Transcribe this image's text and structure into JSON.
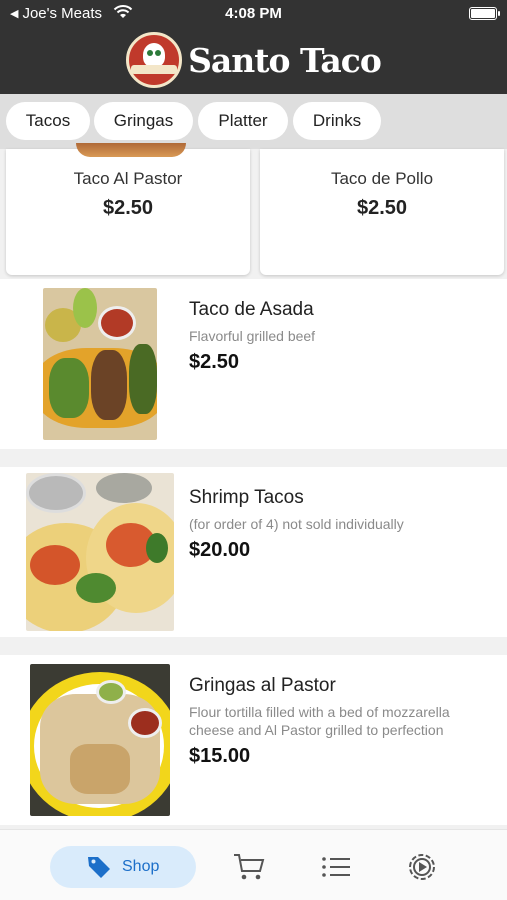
{
  "status": {
    "carrier_back": "Joe's Meats",
    "time": "4:08 PM"
  },
  "header": {
    "title": "Santo Taco",
    "logo_text": "SANTO TACO"
  },
  "categories": [
    "Tacos",
    "Gringas",
    "Platter",
    "Drinks"
  ],
  "featured": [
    {
      "name": "Taco Al Pastor",
      "price": "$2.50"
    },
    {
      "name": "Taco de Pollo",
      "price": "$2.50"
    }
  ],
  "items": [
    {
      "name": "Taco de Asada",
      "desc": "Flavorful grilled beef",
      "price": "$2.50",
      "icon": "taco-asada-photo"
    },
    {
      "name": "Shrimp Tacos",
      "desc": "(for order of 4) not sold individually",
      "price": "$20.00",
      "icon": "shrimp-tacos-photo"
    },
    {
      "name": "Gringas al Pastor",
      "desc": "Flour tortilla filled with a bed of mozzarella cheese and Al Pastor grilled to perfection",
      "price": "$15.00",
      "icon": "gringas-photo"
    }
  ],
  "nav": {
    "shop_label": "Shop",
    "icons": [
      "shop-tag-icon",
      "cart-icon",
      "list-icon",
      "settings-icon"
    ]
  },
  "colors": {
    "header_bg": "#333333",
    "accent": "#1c6fc9",
    "accent_bg": "#d9ebfb"
  }
}
